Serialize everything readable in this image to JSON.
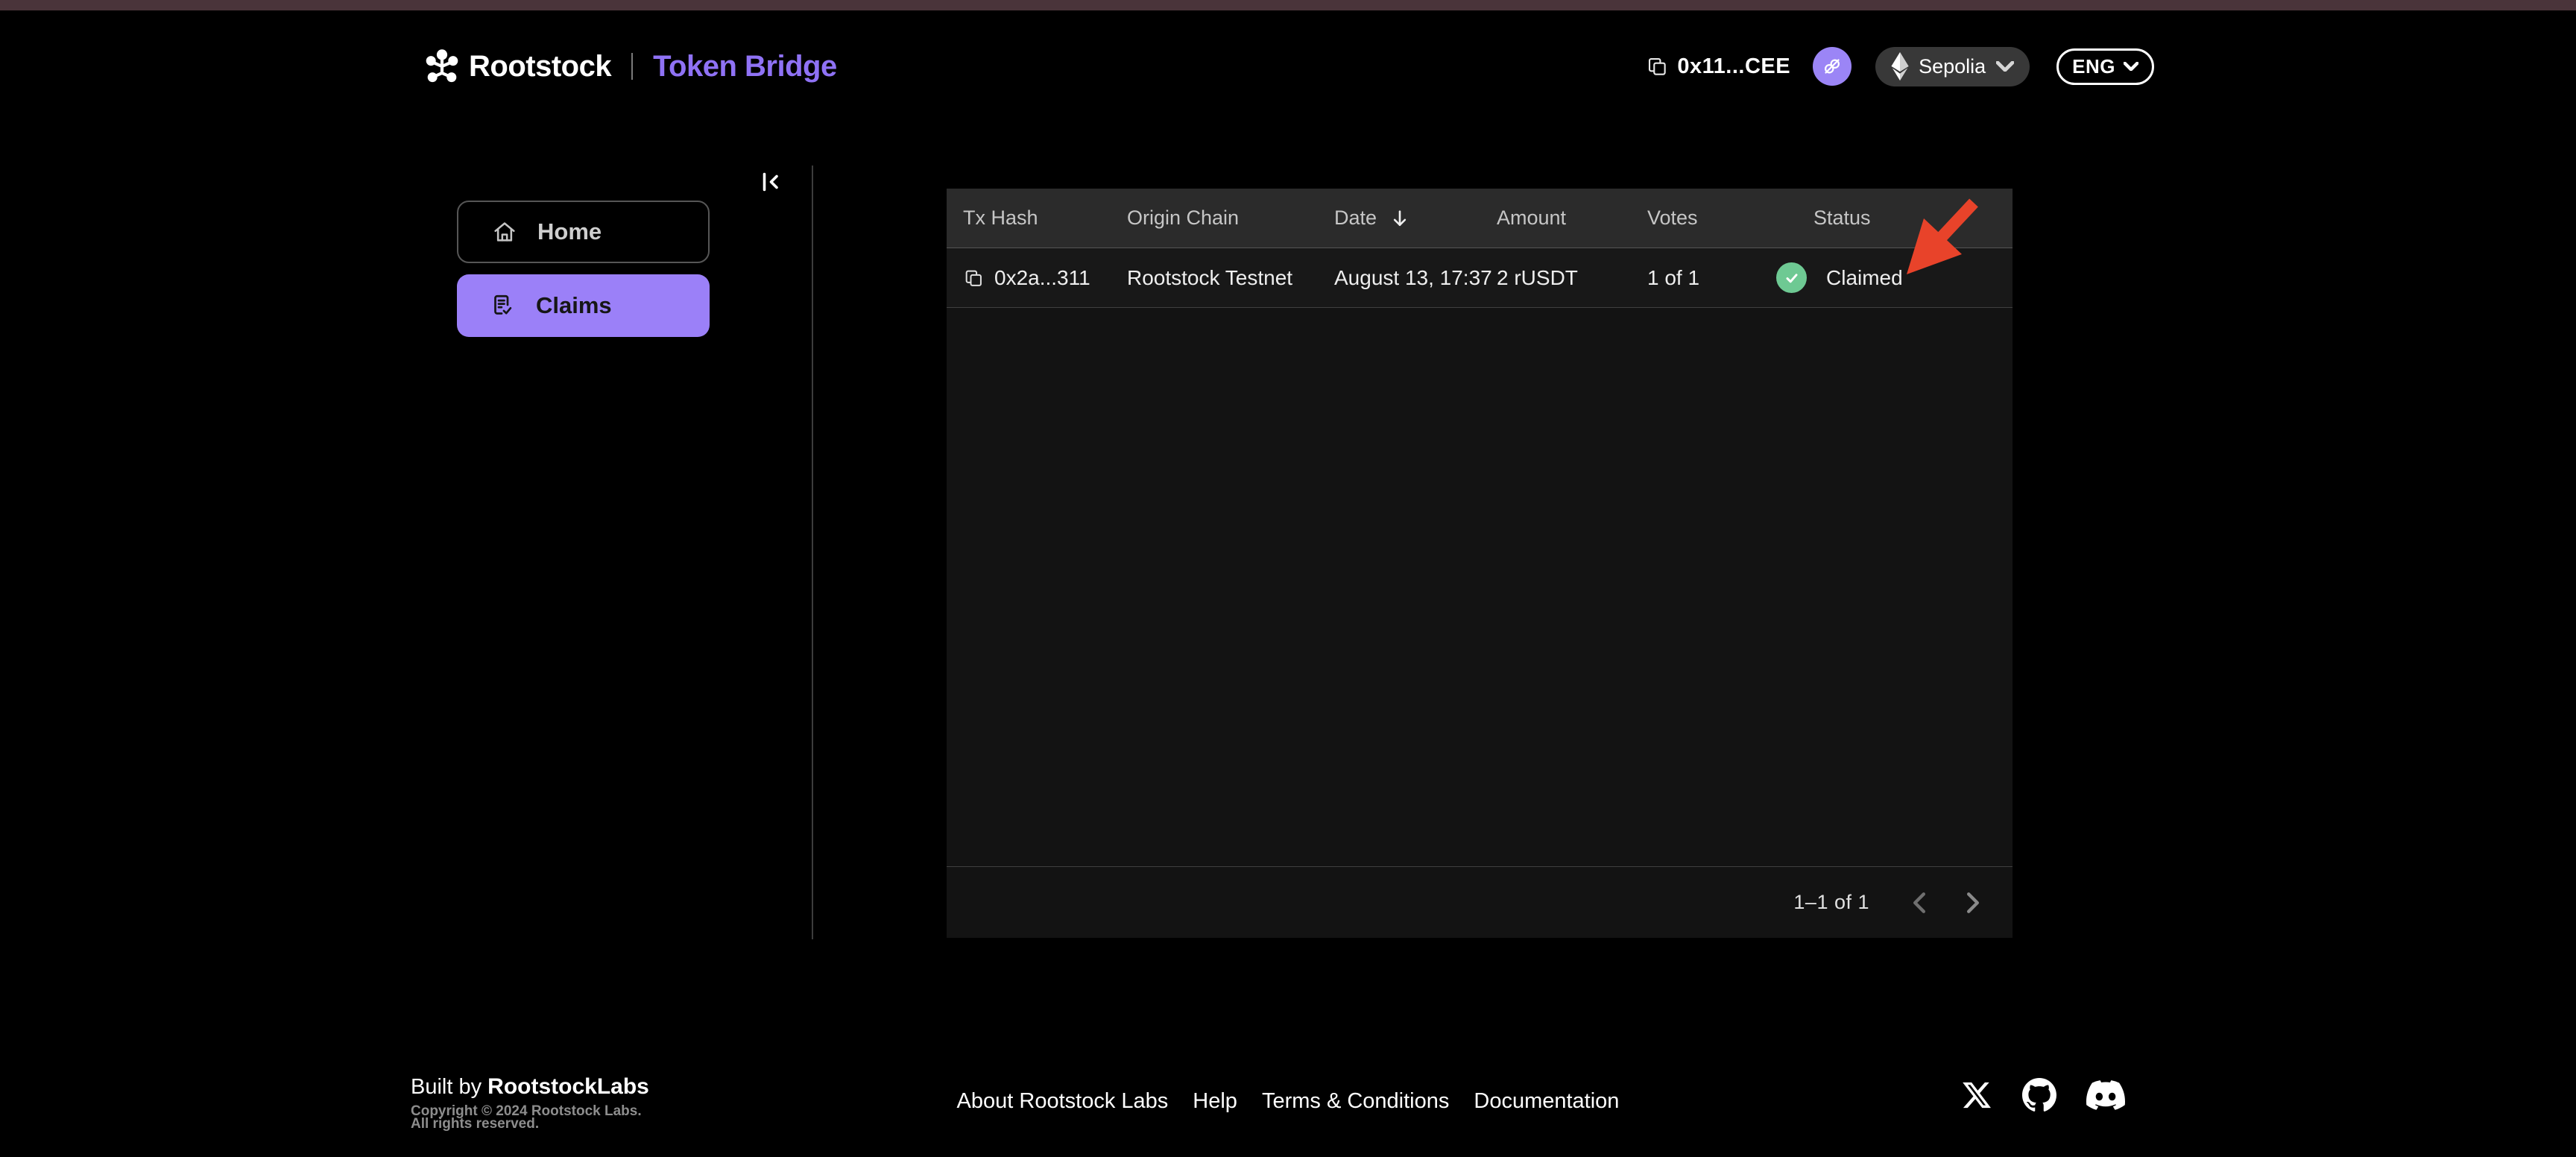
{
  "header": {
    "brand_name": "Rootstock",
    "brand_product": "Token Bridge",
    "wallet_address": "0x11...CEE",
    "network_label": "Sepolia",
    "language_label": "ENG"
  },
  "sidebar": {
    "home_label": "Home",
    "claims_label": "Claims"
  },
  "table": {
    "columns": {
      "tx_hash": "Tx Hash",
      "origin_chain": "Origin Chain",
      "date": "Date",
      "amount": "Amount",
      "votes": "Votes",
      "status": "Status"
    },
    "rows": [
      {
        "tx_hash": "0x2a...311",
        "origin_chain": "Rootstock Testnet",
        "date": "August 13, 17:37",
        "amount": "2 rUSDT",
        "votes": "1 of 1",
        "status": "Claimed"
      }
    ],
    "pagination_label": "1–1 of 1"
  },
  "footer": {
    "built_by_prefix": "Built by ",
    "built_by_brand": "RootstockLabs",
    "copyright_line1": "Copyright © 2024 Rootstock Labs.",
    "copyright_line2": "All rights reserved.",
    "links": [
      "About Rootstock Labs",
      "Help",
      "Terms & Conditions",
      "Documentation"
    ]
  },
  "colors": {
    "accent_purple": "#9b80f8",
    "brand_text_purple": "#8f72f5",
    "status_green": "#6ec993",
    "annotation_red": "#e8432a",
    "top_strip": "#4a343a",
    "table_header_bg": "#2b2b2b"
  }
}
